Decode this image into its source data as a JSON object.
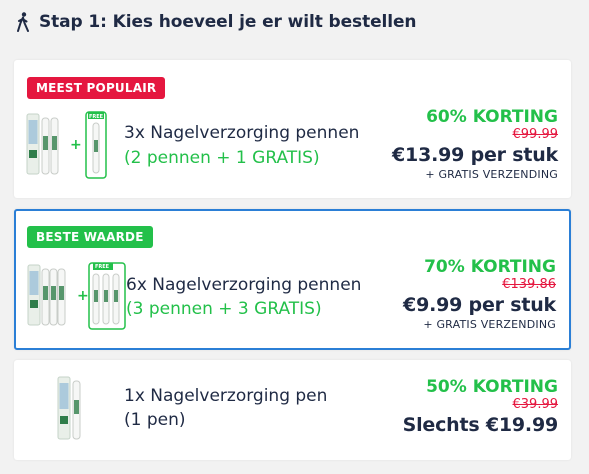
{
  "header": {
    "step_title": "Stap 1: Kies hoeveel je er wilt bestellen"
  },
  "offers": [
    {
      "badge": "MEEST POPULAIR",
      "title": "3x Nagelverzorging pennen",
      "subtitle": "(2 pennen + 1 GRATIS)",
      "discount": "60% KORTING",
      "old_price": "€99.99",
      "price": "€13.99 per stuk",
      "shipping": "+ GRATIS VERZENDING",
      "free_label": "FREE"
    },
    {
      "badge": "BESTE WAARDE",
      "title": "6x Nagelverzorging pennen",
      "subtitle": "(3 pennen + 3 GRATIS)",
      "discount": "70% KORTING",
      "old_price": "€139.86",
      "price": "€9.99 per stuk",
      "shipping": "+ GRATIS VERZENDING",
      "free_label": "FREE"
    },
    {
      "title": "1x Nagelverzorging pen",
      "subtitle": "(1 pen)",
      "discount": "50% KORTING",
      "old_price": "€39.99",
      "price": "Slechts €19.99"
    }
  ],
  "colors": {
    "accent_green": "#23c04a",
    "accent_red": "#e5173f",
    "selected_border": "#2b7fd6",
    "text_dark": "#1f2a44"
  },
  "icons": {
    "header": "walking-person-icon",
    "plus": "plus-icon"
  }
}
